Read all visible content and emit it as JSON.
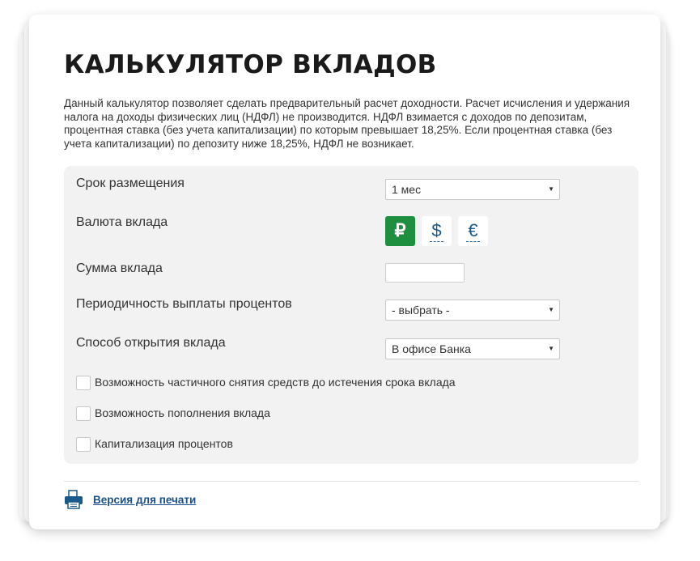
{
  "page": {
    "title": "КАЛЬКУЛЯТОР ВКЛАДОВ",
    "description": "Данный калькулятор позволяет сделать предварительный расчет доходности. Расчет исчисления и удержания налога на доходы физических лиц (НДФЛ) не производится. НДФЛ взимается с доходов по депозитам, процентная ставка (без учета капитализации) по которым превышает 18,25%. Если процентная ставка (без учета капитализации) по депозиту ниже 18,25%, НДФЛ не возникает."
  },
  "form": {
    "term": {
      "label": "Срок размещения",
      "value": "1 мес"
    },
    "currency": {
      "label": "Валюта вклада",
      "options": [
        {
          "symbol": "₽",
          "icon": "ruble-icon",
          "selected": true
        },
        {
          "symbol": "$",
          "icon": "dollar-icon",
          "selected": false
        },
        {
          "symbol": "€",
          "icon": "euro-icon",
          "selected": false
        }
      ]
    },
    "amount": {
      "label": "Сумма вклада",
      "value": ""
    },
    "payout_frequency": {
      "label": "Периодичность выплаты процентов",
      "value": "- выбрать -"
    },
    "opening_method": {
      "label": "Способ открытия вклада",
      "value": "В офисе Банка"
    },
    "checkboxes": [
      {
        "label": "Возможность частичного снятия средств до истечения срока вклада",
        "checked": false
      },
      {
        "label": "Возможность пополнения вклада",
        "checked": false
      },
      {
        "label": "Капитализация процентов",
        "checked": false
      }
    ]
  },
  "footer": {
    "print_label": "Версия для печати",
    "print_icon": "printer-icon"
  },
  "colors": {
    "accent_green": "#1e8f3e",
    "link_blue": "#1a4f8a",
    "panel_bg": "#f2f2f2"
  }
}
